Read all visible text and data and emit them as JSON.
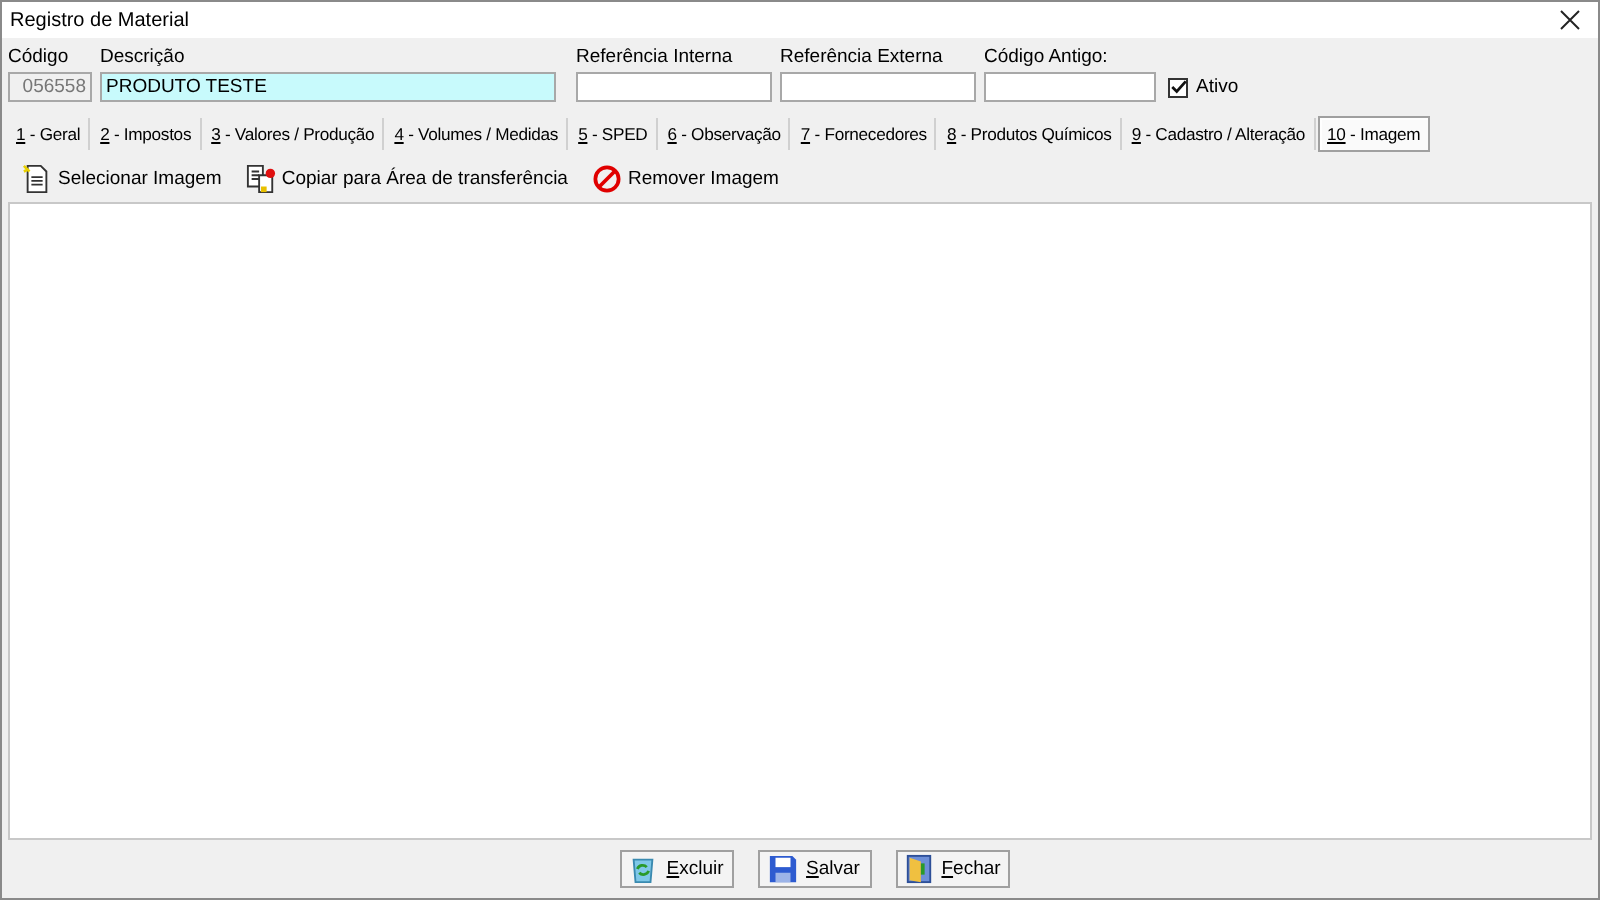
{
  "window": {
    "title": "Registro de Material"
  },
  "fields": [
    {
      "label": "Código",
      "value": "056558",
      "disabled": true,
      "highlighted": false
    },
    {
      "label": "Descrição",
      "value": "PRODUTO TESTE",
      "disabled": false,
      "highlighted": true
    },
    {
      "label": "Referência Interna",
      "disabled": false,
      "highlighted": false
    },
    {
      "label": "Referência Externa",
      "disabled": false,
      "highlighted": false
    },
    {
      "label": "Código Antigo:",
      "disabled": false,
      "highlighted": false
    }
  ],
  "active_checkbox": {
    "label": "Ativo",
    "checked": true
  },
  "tabs": [
    {
      "key": "1",
      "rest": " - Geral",
      "selected": false
    },
    {
      "key": "2",
      "rest": " - Impostos",
      "selected": false
    },
    {
      "key": "3",
      "rest": " - Valores / Produção",
      "selected": false
    },
    {
      "key": "4",
      "rest": " - Volumes / Medidas",
      "selected": false
    },
    {
      "key": "5",
      "rest": " - SPED",
      "selected": false
    },
    {
      "key": "6",
      "rest": " - Observação",
      "selected": false
    },
    {
      "key": "7",
      "rest": " - Fornecedores",
      "selected": false
    },
    {
      "key": "8",
      "rest": " - Produtos Químicos",
      "selected": false
    },
    {
      "key": "9",
      "rest": " - Cadastro / Alteração",
      "selected": false
    },
    {
      "key": "10",
      "rest": " - Imagem",
      "selected": true
    }
  ],
  "toolbar": [
    {
      "kind": "select",
      "label": "Selecionar Imagem"
    },
    {
      "kind": "copy",
      "label": "Copiar para Área de transferência"
    },
    {
      "kind": "remove",
      "label": "Remover Imagem"
    }
  ],
  "buttons": [
    {
      "kind": "delete",
      "key": "E",
      "rest": "xcluir"
    },
    {
      "kind": "save",
      "key": "S",
      "rest": "alvar"
    },
    {
      "kind": "close",
      "key": "F",
      "rest": "echar"
    }
  ]
}
